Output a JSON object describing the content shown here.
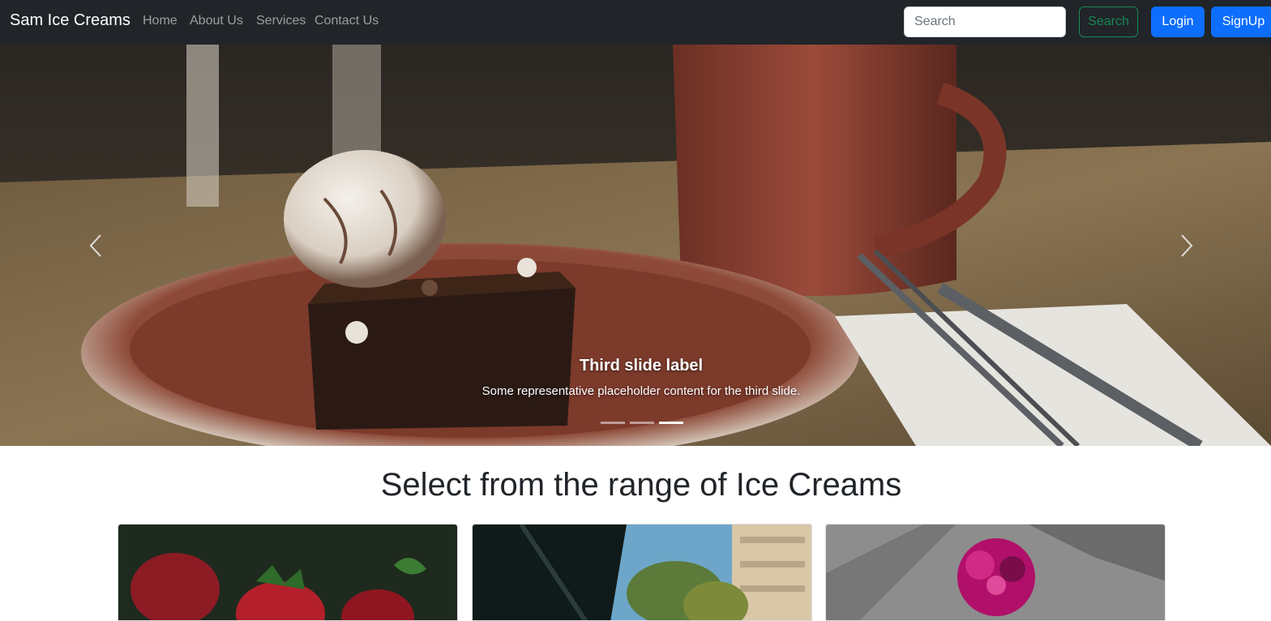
{
  "navbar": {
    "brand": "Sam Ice Creams",
    "links": [
      "Home",
      "About Us",
      "Services",
      "Contact Us"
    ],
    "search_placeholder": "Search",
    "search_button": "Search",
    "login_button": "Login",
    "signup_button": "SignUp"
  },
  "carousel": {
    "caption_title": "Third slide label",
    "caption_text": "Some representative placeholder content for the third slide.",
    "active_slide": 3,
    "slide_count": 3,
    "prev_icon": "chevron-left-icon",
    "next_icon": "chevron-right-icon"
  },
  "section": {
    "title": "Select from the range of Ice Creams"
  },
  "colors": {
    "navbar_bg": "#212529",
    "primary": "#0d6efd",
    "success": "#198754"
  }
}
